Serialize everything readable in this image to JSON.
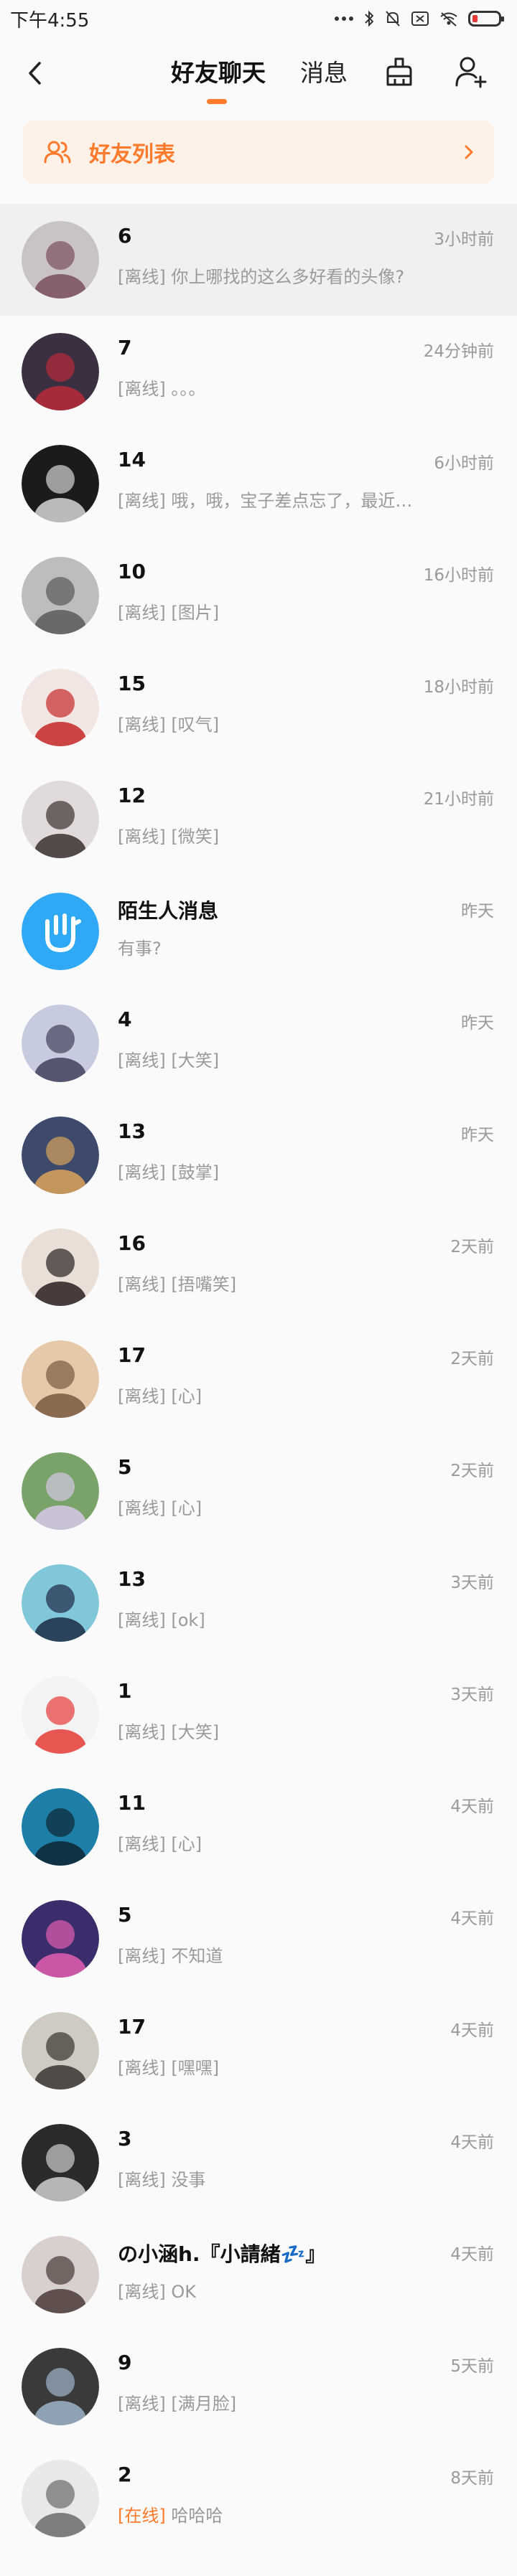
{
  "status_bar": {
    "time": "下午4:55"
  },
  "header": {
    "tab_friends": "好友聊天",
    "tab_messages": "消息"
  },
  "friend_list_bar": {
    "label": "好友列表"
  },
  "colors": {
    "accent": "#ff7a2b",
    "muted": "#9a9a9a"
  },
  "conversations": [
    {
      "name": "6",
      "time": "3小时前",
      "status": "[离线]",
      "message": "你上哪找的这么多好看的头像?",
      "avatar_color": "#c9c2c6",
      "avatar_fg": "#7a4f5f",
      "highlighted": true
    },
    {
      "name": "7",
      "time": "24分钟前",
      "status": "[离线]",
      "message": "。。。",
      "avatar_color": "#3b3041",
      "avatar_fg": "#b82a3a"
    },
    {
      "name": "14",
      "time": "6小时前",
      "status": "[离线]",
      "message": "哦，哦，宝子差点忘了，最近在清...",
      "avatar_color": "#1b1b1b",
      "avatar_fg": "#d6d6d6"
    },
    {
      "name": "10",
      "time": "16小时前",
      "status": "[离线]",
      "message": "[图片]",
      "avatar_color": "#bdbdbd",
      "avatar_fg": "#5a5a5a"
    },
    {
      "name": "15",
      "time": "18小时前",
      "status": "[离线]",
      "message": "[叹气]",
      "avatar_color": "#f2e6e3",
      "avatar_fg": "#c62828"
    },
    {
      "name": "12",
      "time": "21小时前",
      "status": "[离线]",
      "message": "[微笑]",
      "avatar_color": "#e0dada",
      "avatar_fg": "#3a3030"
    },
    {
      "name": "陌生人消息",
      "time": "昨天",
      "status": "",
      "message": "有事?",
      "avatar_color": "#2fa9f5",
      "avatar_fg": "#ffffff",
      "is_stranger": true
    },
    {
      "name": "4",
      "time": "昨天",
      "status": "[离线]",
      "message": "[大笑]",
      "avatar_color": "#c7cbe0",
      "avatar_fg": "#40415a"
    },
    {
      "name": "13",
      "time": "昨天",
      "status": "[离线]",
      "message": "[鼓掌]",
      "avatar_color": "#3d4a6b",
      "avatar_fg": "#d9a35a"
    },
    {
      "name": "16",
      "time": "2天前",
      "status": "[离线]",
      "message": "[捂嘴笑]",
      "avatar_color": "#eadfd6",
      "avatar_fg": "#2a2020"
    },
    {
      "name": "17",
      "time": "2天前",
      "status": "[离线]",
      "message": "[心]",
      "avatar_color": "#e5c9a8",
      "avatar_fg": "#7a5a40"
    },
    {
      "name": "5",
      "time": "2天前",
      "status": "[离线]",
      "message": "[心]",
      "avatar_color": "#7aa36a",
      "avatar_fg": "#d6c8e6"
    },
    {
      "name": "13",
      "time": "3天前",
      "status": "[离线]",
      "message": "[ok]",
      "avatar_color": "#7fc7d9",
      "avatar_fg": "#1c2a44"
    },
    {
      "name": "1",
      "time": "3天前",
      "status": "[离线]",
      "message": "[大笑]",
      "avatar_color": "#f3f3f3",
      "avatar_fg": "#e53935"
    },
    {
      "name": "11",
      "time": "4天前",
      "status": "[离线]",
      "message": "[心]",
      "avatar_color": "#1e7fa8",
      "avatar_fg": "#0d2533"
    },
    {
      "name": "5",
      "time": "4天前",
      "status": "[离线]",
      "message": "不知道",
      "avatar_color": "#3b2d6b",
      "avatar_fg": "#e35fb0"
    },
    {
      "name": "17",
      "time": "4天前",
      "status": "[离线]",
      "message": "[嘿嘿]",
      "avatar_color": "#cfcac2",
      "avatar_fg": "#3a3530"
    },
    {
      "name": "3",
      "time": "4天前",
      "status": "[离线]",
      "message": "没事",
      "avatar_color": "#2b2b2b",
      "avatar_fg": "#cfcfcf"
    },
    {
      "name": "の小涵h.『小請緒💤』",
      "time": "4天前",
      "status": "[离线]",
      "message": "OK",
      "avatar_color": "#d8d0cd",
      "avatar_fg": "#4a3a36"
    },
    {
      "name": "9",
      "time": "5天前",
      "status": "[离线]",
      "message": "[满月脸]",
      "avatar_color": "#3a3a3a",
      "avatar_fg": "#9fb5c9"
    },
    {
      "name": "2",
      "time": "8天前",
      "status": "[在线]",
      "message": "哈哈哈",
      "avatar_color": "#e8e8ea",
      "avatar_fg": "#6b6b6b",
      "online": true
    }
  ]
}
